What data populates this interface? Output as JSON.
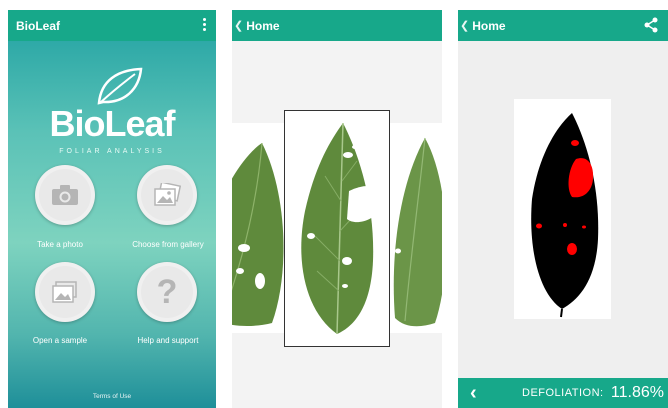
{
  "screens": {
    "main": {
      "app_title": "BioLeaf",
      "brand": "BioLeaf",
      "tagline": "FOLIAR ANALYSIS",
      "actions": [
        {
          "label": "Take a photo",
          "icon": "camera-icon"
        },
        {
          "label": "Choose from gallery",
          "icon": "gallery-icon"
        },
        {
          "label": "Open a sample",
          "icon": "sample-image-icon"
        },
        {
          "label": "Help and support",
          "icon": "question-mark-icon"
        }
      ],
      "footer_link": "Terms of Use"
    },
    "gallery": {
      "back_title": "Home"
    },
    "result": {
      "back_title": "Home",
      "metric_label": "DEFOLIATION:",
      "metric_value": "11.86%"
    }
  },
  "colors": {
    "app_bar": "#17a88a",
    "gradient_top": "#2ea9a7",
    "gradient_bottom": "#1e8f99",
    "leaf_green": "#5f8a3c",
    "damage_red": "#ff0000"
  }
}
